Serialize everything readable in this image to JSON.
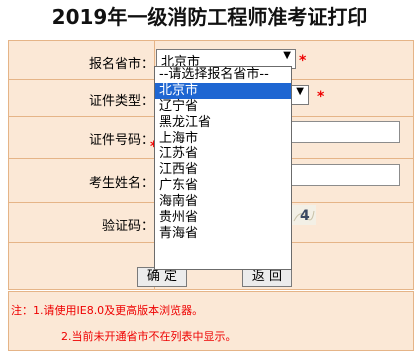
{
  "page": {
    "title": "2019年一级消防工程师准考证打印"
  },
  "form": {
    "province": {
      "label": "报名省市：",
      "value": "北京市",
      "required_mark": "*"
    },
    "id_type": {
      "label": "证件类型：",
      "required_mark": "*"
    },
    "id_number": {
      "label": "证件号码：",
      "required_mark": "*"
    },
    "name": {
      "label": "考生姓名："
    },
    "captcha": {
      "label": "验证码：",
      "image_text": "4"
    },
    "buttons": {
      "confirm": "确 定",
      "back": "返 回"
    }
  },
  "province_dropdown": {
    "options": [
      "--请选择报名省市--",
      "北京市",
      "辽宁省",
      "黑龙江省",
      "上海市",
      "江苏省",
      "江西省",
      "广东省",
      "海南省",
      "贵州省",
      "青海省"
    ],
    "selected_index": 1
  },
  "notes": {
    "line1": "注：1.请使用IE8.0及更高版本浏览器。",
    "line2": "2.当前未开通省市不在列表中显示。"
  },
  "colors": {
    "form_background": "#fbe8d6",
    "border": "#e5b487",
    "required_mark": "#ee0000",
    "dropdown_highlight": "#1e66d2"
  }
}
